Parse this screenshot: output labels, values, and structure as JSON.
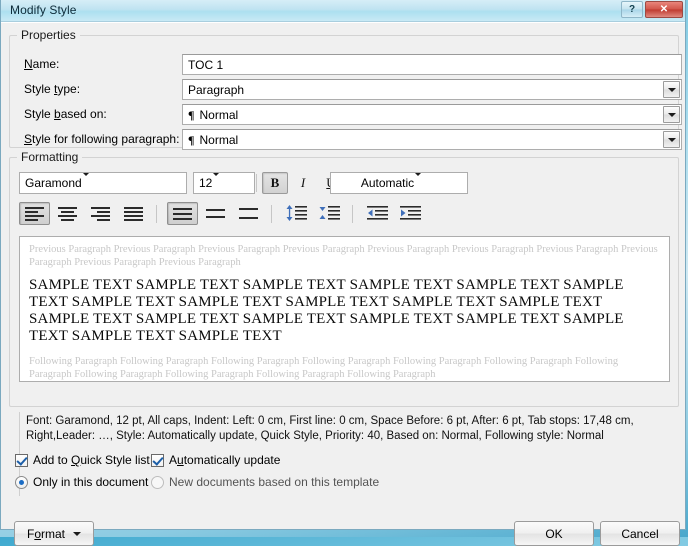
{
  "window": {
    "title": "Modify Style",
    "help_button": "?",
    "close_button": "✕"
  },
  "properties": {
    "legend": "Properties",
    "fields": [
      {
        "label_pre": "N",
        "label_key": "a",
        "label_post": "me:",
        "value": "TOC 1",
        "type": "textbox"
      },
      {
        "label_pre": "Style ",
        "label_key": "t",
        "label_post": "ype:",
        "value": "Paragraph",
        "type": "combo"
      },
      {
        "label_pre": "Style ",
        "label_key": "b",
        "label_post": "ased on:",
        "value": "Normal",
        "prefix": "¶",
        "type": "combo"
      },
      {
        "label_pre": "",
        "label_key": "S",
        "label_post": "tyle for following paragraph:",
        "value": "Normal",
        "prefix": "¶",
        "type": "combo"
      }
    ]
  },
  "formatting": {
    "legend": "Formatting",
    "font_name": "Garamond",
    "font_size": "12",
    "font_color": "Automatic",
    "bold_label": "B",
    "italic_label": "I",
    "underline_label": "U",
    "bold_active": true,
    "italic_active": false,
    "underline_active": false,
    "align_active_index": 0,
    "spacing_active_index": 0
  },
  "preview": {
    "previous_paragraph": "Previous Paragraph Previous Paragraph Previous Paragraph Previous Paragraph Previous Paragraph Previous Paragraph Previous Paragraph Previous Paragraph Previous Paragraph Previous Paragraph",
    "sample_text": "SAMPLE TEXT SAMPLE TEXT SAMPLE TEXT SAMPLE TEXT SAMPLE TEXT SAMPLE TEXT SAMPLE TEXT SAMPLE TEXT SAMPLE TEXT SAMPLE TEXT SAMPLE TEXT SAMPLE TEXT SAMPLE TEXT SAMPLE TEXT SAMPLE TEXT SAMPLE TEXT SAMPLE TEXT SAMPLE TEXT SAMPLE TEXT",
    "following_paragraph": "Following Paragraph Following Paragraph Following Paragraph Following Paragraph Following Paragraph Following Paragraph Following Paragraph Following Paragraph Following Paragraph Following Paragraph Following Paragraph"
  },
  "description": "Font: Garamond, 12 pt, All caps, Indent: Left:  0 cm, First line:  0 cm, Space Before:  6 pt, After:  6 pt, Tab stops:  17,48 cm, Right,Leader: …, Style: Automatically update, Quick Style, Priority: 40, Based on: Normal, Following style: Normal",
  "options": {
    "add_to_quick_style_list": "Add to Quick Style list",
    "add_to_quick_style_list_checked": true,
    "automatically_update": "Automatically update",
    "automatically_update_checked": true,
    "only_in_this_document": "Only in this document",
    "only_in_this_document_selected": true,
    "new_documents_based_on_template": "New documents based on this template",
    "new_documents_based_on_template_selected": false
  },
  "buttons": {
    "format": "Format",
    "ok": "OK",
    "cancel": "Cancel"
  }
}
